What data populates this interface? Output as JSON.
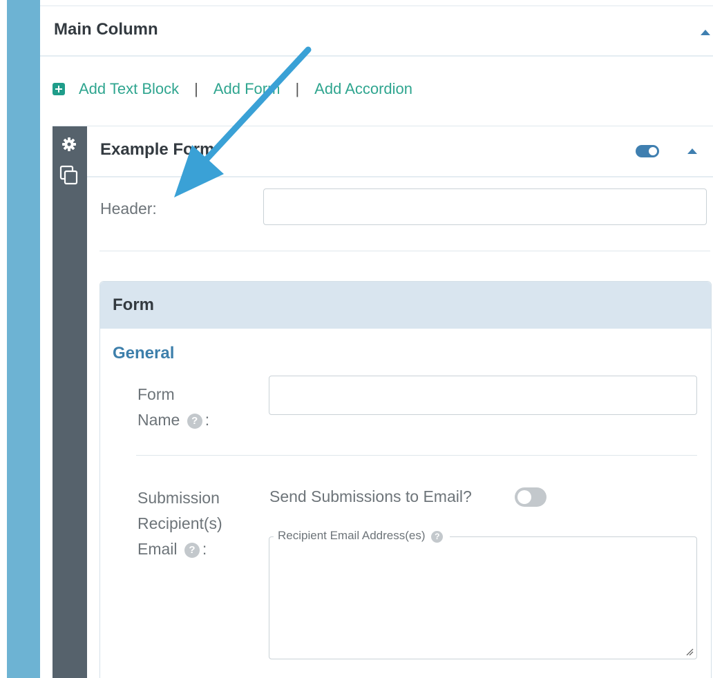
{
  "main_column": {
    "title": "Main Column"
  },
  "add_actions": {
    "text_block": "Add Text Block",
    "separator": "|",
    "form": "Add Form",
    "accordion": "Add Accordion"
  },
  "block": {
    "title": "Example Form",
    "enabled": true,
    "header_label": "Header:",
    "header_value": ""
  },
  "form_card": {
    "title": "Form",
    "section": "General",
    "form_name_label_line1": "Form",
    "form_name_label_line2": "Name",
    "form_name_value": "",
    "colon": ":",
    "recipient_label_line1": "Submission",
    "recipient_label_line2": "Recipient(s)",
    "recipient_label_line3": "Email",
    "send_to_email_label": "Send Submissions to Email?",
    "send_to_email_enabled": false,
    "recipient_legend": "Recipient Email Address(es)",
    "recipient_value": ""
  },
  "icons": {
    "help": "?",
    "add": "plus-square-icon",
    "settings": "gear-icon",
    "duplicate": "copy-icon",
    "collapse": "caret-up-icon"
  },
  "colors": {
    "accent_blue": "#3f7fb0",
    "link_green": "#2fa58f",
    "rail_blue": "#6db3d3",
    "tool_rail": "#56626c",
    "annotation_arrow": "#3aa1d6"
  }
}
